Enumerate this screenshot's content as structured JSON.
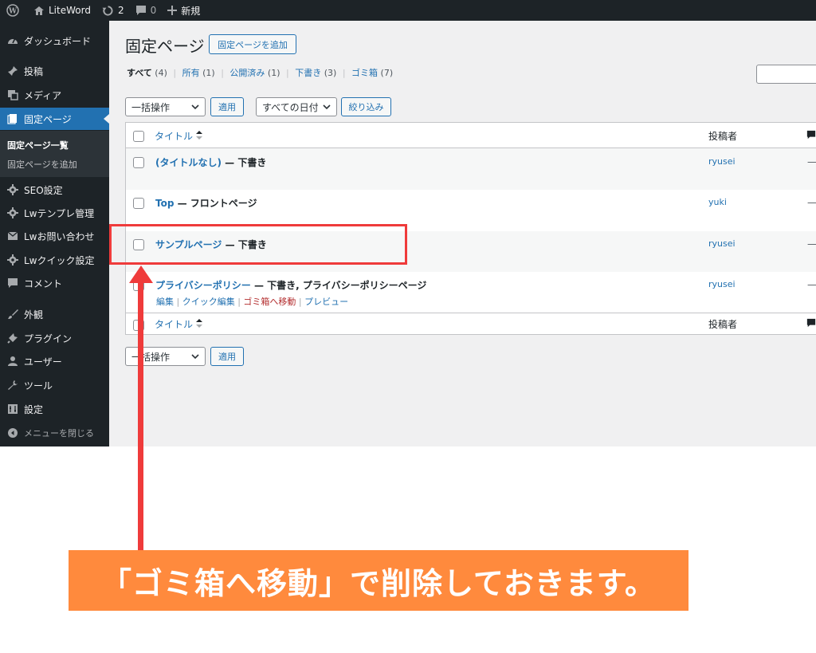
{
  "admin_bar": {
    "site_name": "LiteWord",
    "updates_count": "2",
    "comments_count": "0",
    "new_label": "新規"
  },
  "sidebar": {
    "items": [
      {
        "label": "ダッシュボード",
        "icon": "dashboard-icon"
      },
      {
        "label": "投稿",
        "icon": "pin-icon"
      },
      {
        "label": "メディア",
        "icon": "media-icon"
      },
      {
        "label": "固定ページ",
        "icon": "page-icon"
      },
      {
        "label": "SEO設定",
        "icon": "gear-icon"
      },
      {
        "label": "Lwテンプレ管理",
        "icon": "gear-icon"
      },
      {
        "label": "Lwお問い合わせ",
        "icon": "mail-icon"
      },
      {
        "label": "Lwクイック設定",
        "icon": "gear-icon"
      },
      {
        "label": "コメント",
        "icon": "comment-icon"
      },
      {
        "label": "外観",
        "icon": "brush-icon"
      },
      {
        "label": "プラグイン",
        "icon": "plugin-icon"
      },
      {
        "label": "ユーザー",
        "icon": "user-icon"
      },
      {
        "label": "ツール",
        "icon": "wrench-icon"
      },
      {
        "label": "設定",
        "icon": "settings-icon"
      }
    ],
    "submenu": [
      {
        "label": "固定ページ一覧"
      },
      {
        "label": "固定ページを追加"
      }
    ],
    "collapse_label": "メニューを閉じる"
  },
  "page": {
    "title": "固定ページ",
    "add_button": "固定ページを追加",
    "filters": [
      {
        "label": "すべて",
        "count": "(4)"
      },
      {
        "label": "所有",
        "count": "(1)"
      },
      {
        "label": "公開済み",
        "count": "(1)"
      },
      {
        "label": "下書き",
        "count": "(3)"
      },
      {
        "label": "ゴミ箱",
        "count": "(7)"
      }
    ],
    "bulk_action": "一括操作",
    "apply_label": "適用",
    "date_filter": "すべての日付",
    "filter_button": "絞り込み"
  },
  "table": {
    "col_title": "タイトル",
    "col_author": "投稿者",
    "rows": [
      {
        "title": "(タイトルなし)",
        "state": " — 下書き",
        "author": "ryusei",
        "comments": "—"
      },
      {
        "title": "Top",
        "state": " — フロントページ",
        "author": "yuki",
        "comments": "—"
      },
      {
        "title": "サンプルページ",
        "state": " — 下書き",
        "author": "ryusei",
        "comments": "—"
      },
      {
        "title": "プライバシーポリシー",
        "state": " — 下書き, プライバシーポリシーページ",
        "author": "ryusei",
        "comments": "—"
      }
    ],
    "row_actions": {
      "edit": "編集",
      "quick_edit": "クイック編集",
      "trash": "ゴミ箱へ移動",
      "preview": "プレビュー"
    }
  },
  "annotation": {
    "callout": "「ゴミ箱へ移動」で削除しておきます。"
  }
}
